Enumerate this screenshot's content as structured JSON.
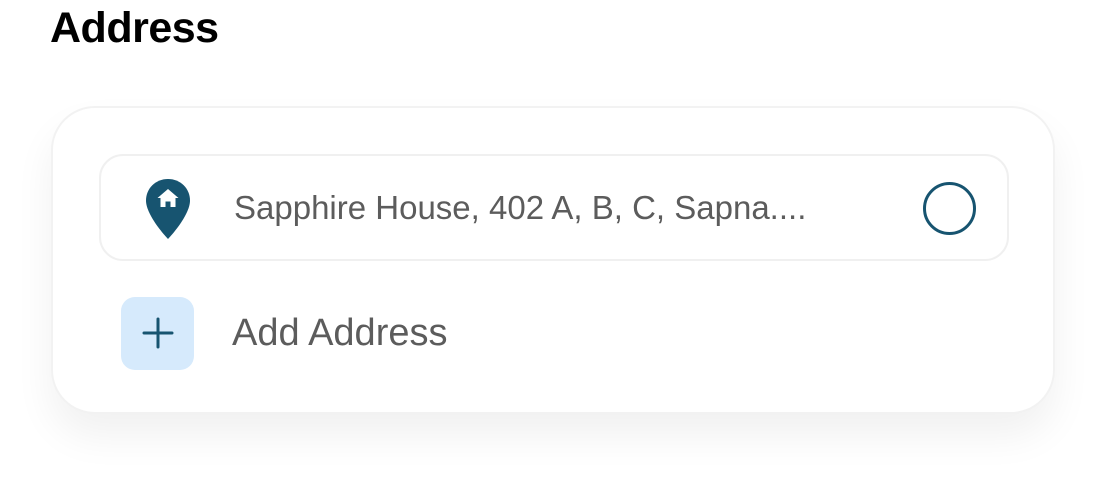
{
  "section": {
    "title": "Address"
  },
  "addresses": [
    {
      "text": "Sapphire House, 402 A, B, C, Sapna....",
      "icon": "home-location-pin-icon",
      "selected": false
    }
  ],
  "add_address": {
    "label": "Add Address",
    "icon": "plus-icon"
  },
  "colors": {
    "accent": "#175470",
    "add_icon_bg": "#d6eafc",
    "text_muted": "#5c5c5c"
  }
}
